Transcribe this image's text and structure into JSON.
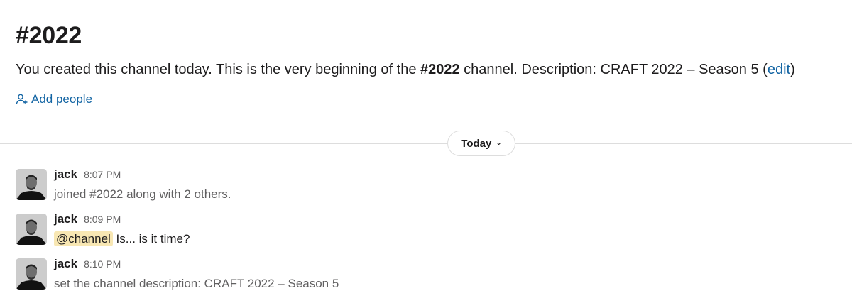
{
  "channel": {
    "title": "#2022",
    "intro_before": "You created this channel today. This is the very beginning of the ",
    "intro_channel": "#2022",
    "intro_after": " channel. Description: CRAFT 2022 – Season 5 (",
    "edit_label": "edit",
    "intro_close": ")",
    "add_people_label": "Add people",
    "add_people_icon": "add-person-icon"
  },
  "day_divider": {
    "label": "Today",
    "chevron": "⌄"
  },
  "messages": [
    {
      "author": "jack",
      "time": "8:07 PM",
      "text": "joined #2022 along with 2 others."
    },
    {
      "author": "jack",
      "time": "8:09 PM",
      "mention": "@channel",
      "text": " Is... is it time?"
    },
    {
      "author": "jack",
      "time": "8:10 PM",
      "text": "set the channel description: CRAFT 2022 – Season 5"
    }
  ],
  "colors": {
    "link": "#1264a3",
    "mention_bg": "#f8e7b3",
    "divider": "#dddddd",
    "muted_text": "#616061"
  }
}
